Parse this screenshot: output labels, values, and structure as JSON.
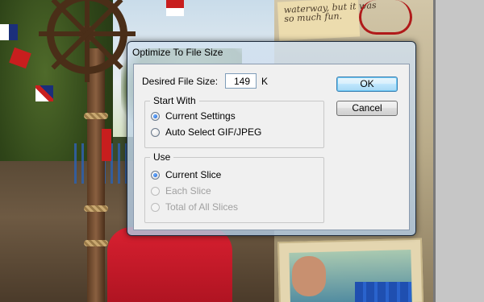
{
  "background": {
    "note_lines": [
      "waterway, but it was",
      "so much fun."
    ]
  },
  "dialog": {
    "title": "Optimize To File Size",
    "desired_file_size_label": "Desired File Size:",
    "desired_file_size_value": "149",
    "desired_file_size_unit": "K",
    "ok_label": "OK",
    "cancel_label": "Cancel",
    "start_with": {
      "title": "Start With",
      "options": [
        {
          "label": "Current Settings",
          "selected": true,
          "enabled": true
        },
        {
          "label": "Auto Select GIF/JPEG",
          "selected": false,
          "enabled": true
        }
      ]
    },
    "use": {
      "title": "Use",
      "options": [
        {
          "label": "Current Slice",
          "selected": true,
          "enabled": true
        },
        {
          "label": "Each Slice",
          "selected": false,
          "enabled": false
        },
        {
          "label": "Total of All Slices",
          "selected": false,
          "enabled": false
        }
      ]
    }
  },
  "colors": {
    "default_button_border": "#3c7fb1",
    "radio_selected": "#1a5fd0",
    "disabled_text": "#a0a0a0"
  }
}
